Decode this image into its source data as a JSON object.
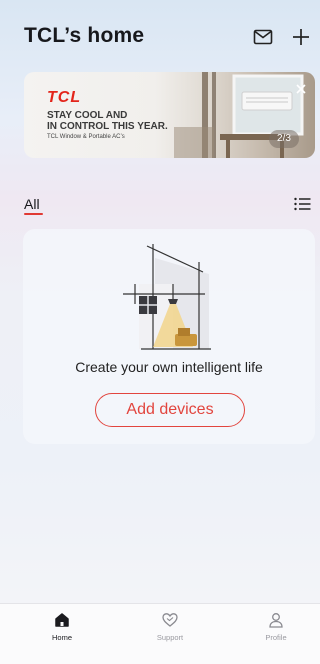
{
  "header": {
    "title": "TCL’s home",
    "icons": {
      "mail": "mail-icon",
      "add": "plus-icon"
    }
  },
  "banner": {
    "brand": "TCL",
    "headline_line1": "STAY COOL AND",
    "headline_line2": "IN CONTROL THIS YEAR.",
    "subline": "TCL Window & Portable AC’s",
    "pager": "2/3",
    "close_icon": "close-icon",
    "colors": {
      "brand": "#e3251b"
    }
  },
  "filter": {
    "tab_all": "All",
    "list_icon": "list-view-icon",
    "accent": "#e03a34"
  },
  "empty_state": {
    "message": "Create your own intelligent life",
    "add_button": "Add devices",
    "accent": "#e2453e"
  },
  "bottom_nav": {
    "items": [
      {
        "label": "Home",
        "icon": "home-icon",
        "active": true
      },
      {
        "label": "Support",
        "icon": "support-heart-icon",
        "active": false
      },
      {
        "label": "Profile",
        "icon": "profile-icon",
        "active": false
      }
    ]
  }
}
